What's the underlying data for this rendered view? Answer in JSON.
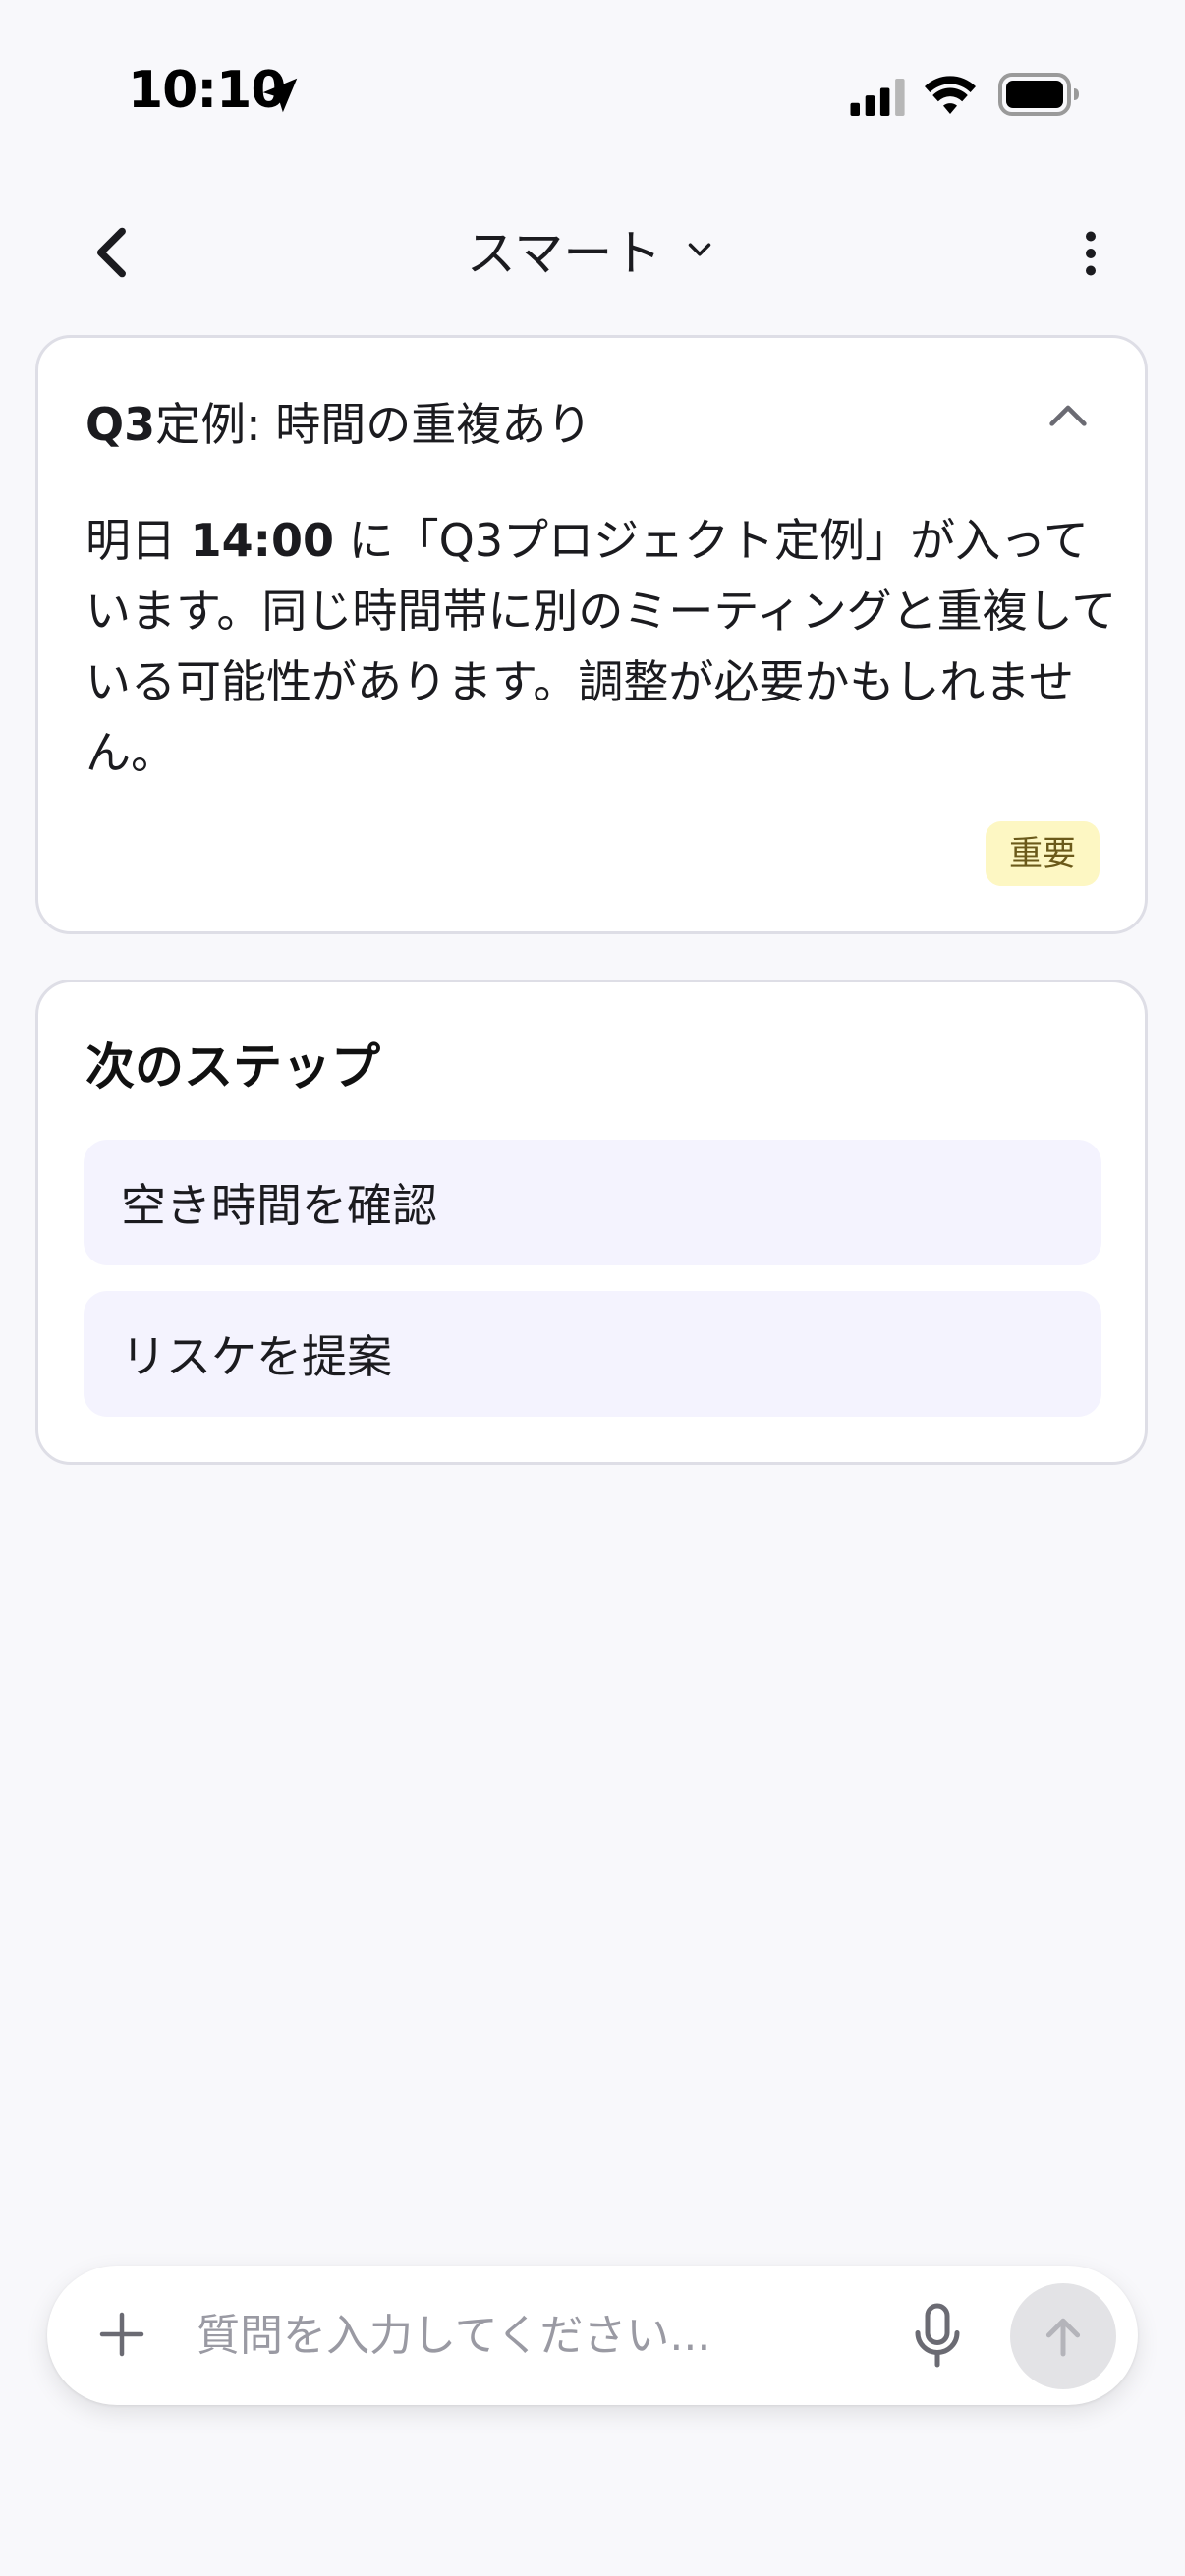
{
  "status_bar": {
    "time": "10:10"
  },
  "nav": {
    "title": "スマート"
  },
  "alert": {
    "title_bold": "Q3",
    "title_rest": "定例: 時間の重複あり",
    "body_prefix": "明日 ",
    "body_time": "14:00",
    "body_rest": " に「Q3プロジェクト定例」が入っています。同じ時間帯に別のミーティングと重複している可能性があります。調整が必要かもしれません。",
    "badge": "重要"
  },
  "next_steps": {
    "title": "次のステップ",
    "items": [
      {
        "label": "空き時間を確認"
      },
      {
        "label": "リスケを提案"
      }
    ]
  },
  "composer": {
    "placeholder": "質問を入力してください..."
  },
  "colors": {
    "background": "#f8f8fb",
    "card_border": "#dedee6",
    "step_background": "#f4f3fe",
    "badge_background": "#fdf7c3",
    "badge_text": "#6b5a1a",
    "send_disabled": "#e3e3e6"
  },
  "icons": {
    "location": "location-arrow-icon",
    "signal": "cellular-signal-icon",
    "wifi": "wifi-icon",
    "battery": "battery-icon",
    "back": "chevron-left-icon",
    "title_dropdown": "chevron-down-icon",
    "more": "more-vertical-icon",
    "collapse": "chevron-up-icon",
    "add": "plus-icon",
    "mic": "microphone-icon",
    "send": "arrow-up-icon"
  }
}
